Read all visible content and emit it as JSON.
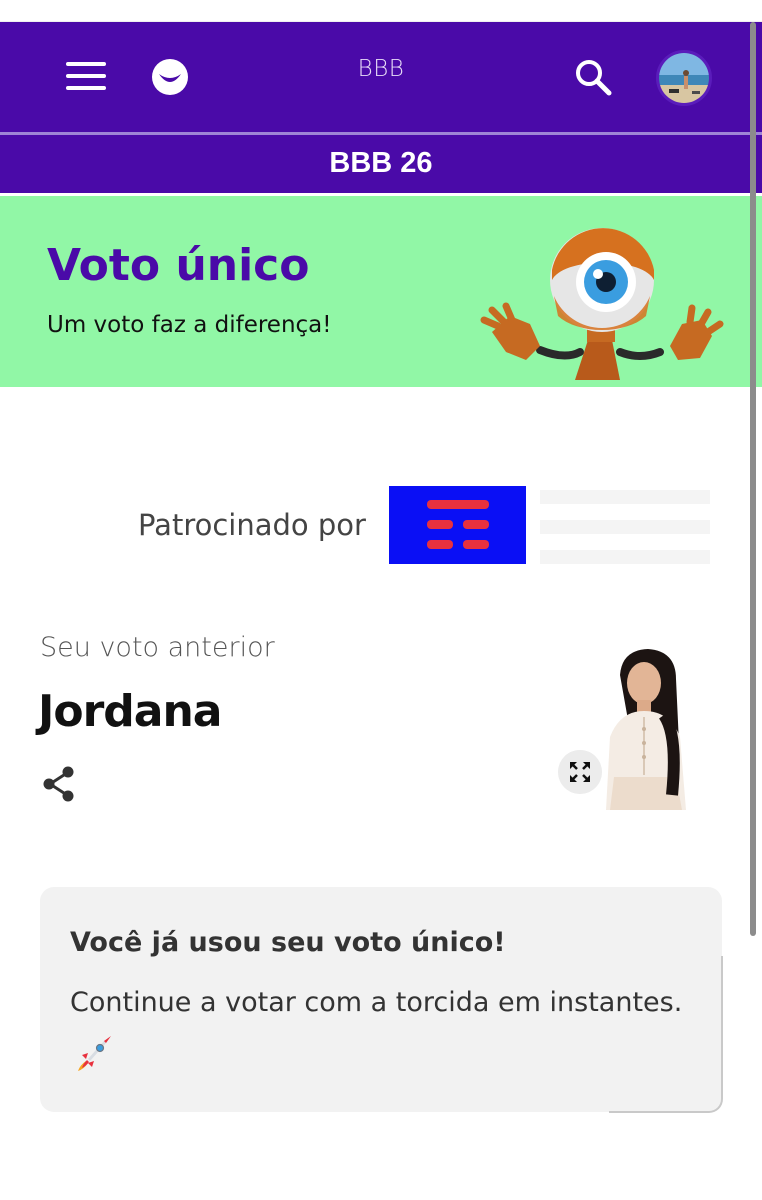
{
  "header": {
    "title": "BBB",
    "menu_icon": "hamburger-menu-icon",
    "logo_icon": "globo-smile-logo-icon",
    "search_icon": "search-icon",
    "avatar_icon": "user-avatar-icon"
  },
  "subnav": {
    "title": "BBB 26"
  },
  "hero": {
    "title": "Voto único",
    "subtitle": "Um voto faz a diferença!",
    "mascot_icon": "big-brother-eye-mascot-icon"
  },
  "sponsor": {
    "label": "Patrocinado por",
    "logo_icon": "sponsor-logo-icon"
  },
  "previous_vote": {
    "label": "Seu voto anterior",
    "name": "Jordana",
    "share_icon": "share-icon",
    "expand_icon": "expand-icon"
  },
  "notice": {
    "title": "Você já usou seu voto único!",
    "body": "Continue a votar com a torcida em instantes.",
    "icon": "rocket-icon"
  },
  "colors": {
    "brand_purple": "#4a0aa8",
    "hero_green": "#91f7a6",
    "sponsor_blue": "#0a0ff5",
    "sponsor_red": "#e8313e",
    "card_gray": "#f2f2f2"
  }
}
